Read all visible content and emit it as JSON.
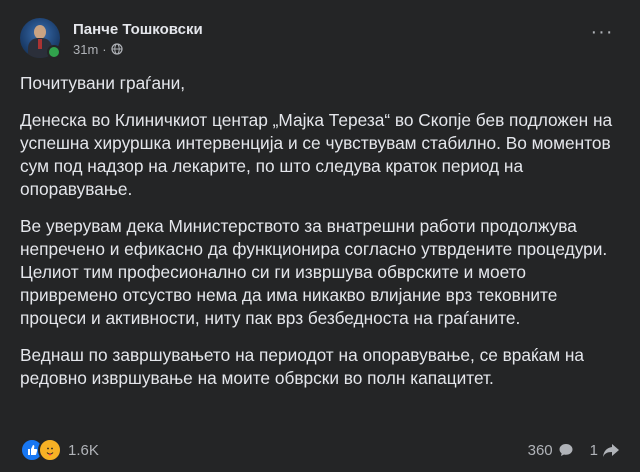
{
  "post": {
    "author": "Панче Тошковски",
    "time": "31m",
    "separator": "·",
    "more_label": "···",
    "paragraphs": [
      "Почитувани граѓани,",
      "Денеска во Клиничкиот центар „Мајка Тереза“ во Скопје бев подложен на успешна хируршка интервенција и се чувствувам стабилно. Во моментов сум под надзор на лекарите, по што следува краток период на опоравување.",
      "Ве уверувам дека Министерството за внатрешни работи продолжува непречено и ефикасно да функционира согласно утврдените процедури. Целиот тим професионално си ги извршува обврските и моето привремено отсуство нема да има никакво влијание врз тековните процеси и активности, ниту пак врз безбедноста на граѓаните.",
      "Веднаш по завршувањето на периодот на опоравување, се враќам на редовно извршување на моите обврски во полн капацитет."
    ]
  },
  "footer": {
    "reactions_count": "1.6K",
    "comments_count": "360",
    "shares_count": "1"
  },
  "colors": {
    "background": "#242526",
    "text": "#e4e6eb",
    "secondary_text": "#b0b3b8",
    "like_blue": "#1877f2",
    "care_yellow": "#f7b125",
    "online_green": "#31a24c"
  },
  "icons": {
    "privacy": "globe-icon",
    "reaction_1": "like-icon",
    "reaction_2": "care-icon",
    "comments": "comment-icon",
    "shares": "share-icon"
  }
}
